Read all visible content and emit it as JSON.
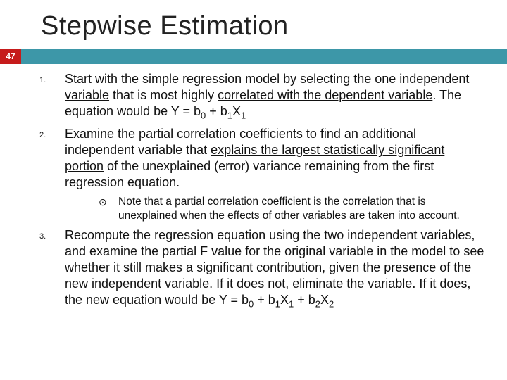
{
  "title": "Stepwise Estimation",
  "page": "47",
  "items": [
    {
      "num": "1.",
      "p1": "Start with the simple regression model by ",
      "u1": "selecting the one independent variable",
      "p2": " that is most highly ",
      "u2": "correlated with the dependent variable",
      "p3": ". The equation would be Y = b",
      "eq_a": "",
      "sub_a": "0",
      "eq_b": " + b",
      "sub_b": "1",
      "eq_c": "X",
      "sub_c": "1"
    },
    {
      "num": "2.",
      "p1": "Examine the partial correlation coefficients to find an additional independent variable that ",
      "u1": "explains the largest statistically significant portion",
      "p2": " of the unexplained (error) variance remaining from the first regression equation."
    },
    {
      "num": "3.",
      "p1": "Recompute the regression equation using the two independent variables, and examine the partial F value for the original variable in the model to see whether it still makes a significant contribution, given the presence of the new independent variable. If it does not, eliminate the variable. If it does, the new equation would be Y = b",
      "eq_a": "",
      "sub_a": "0",
      "eq_b": " + b",
      "sub_b": "1",
      "eq_c": "X",
      "sub_c": "1",
      "eq_d": " + b",
      "sub_d": "2",
      "eq_e": "X",
      "sub_e": "2"
    }
  ],
  "note": {
    "bullet": "⊙",
    "text": "Note that a partial correlation coefficient is the correlation that is unexplained when the effects of other variables are taken into account."
  }
}
